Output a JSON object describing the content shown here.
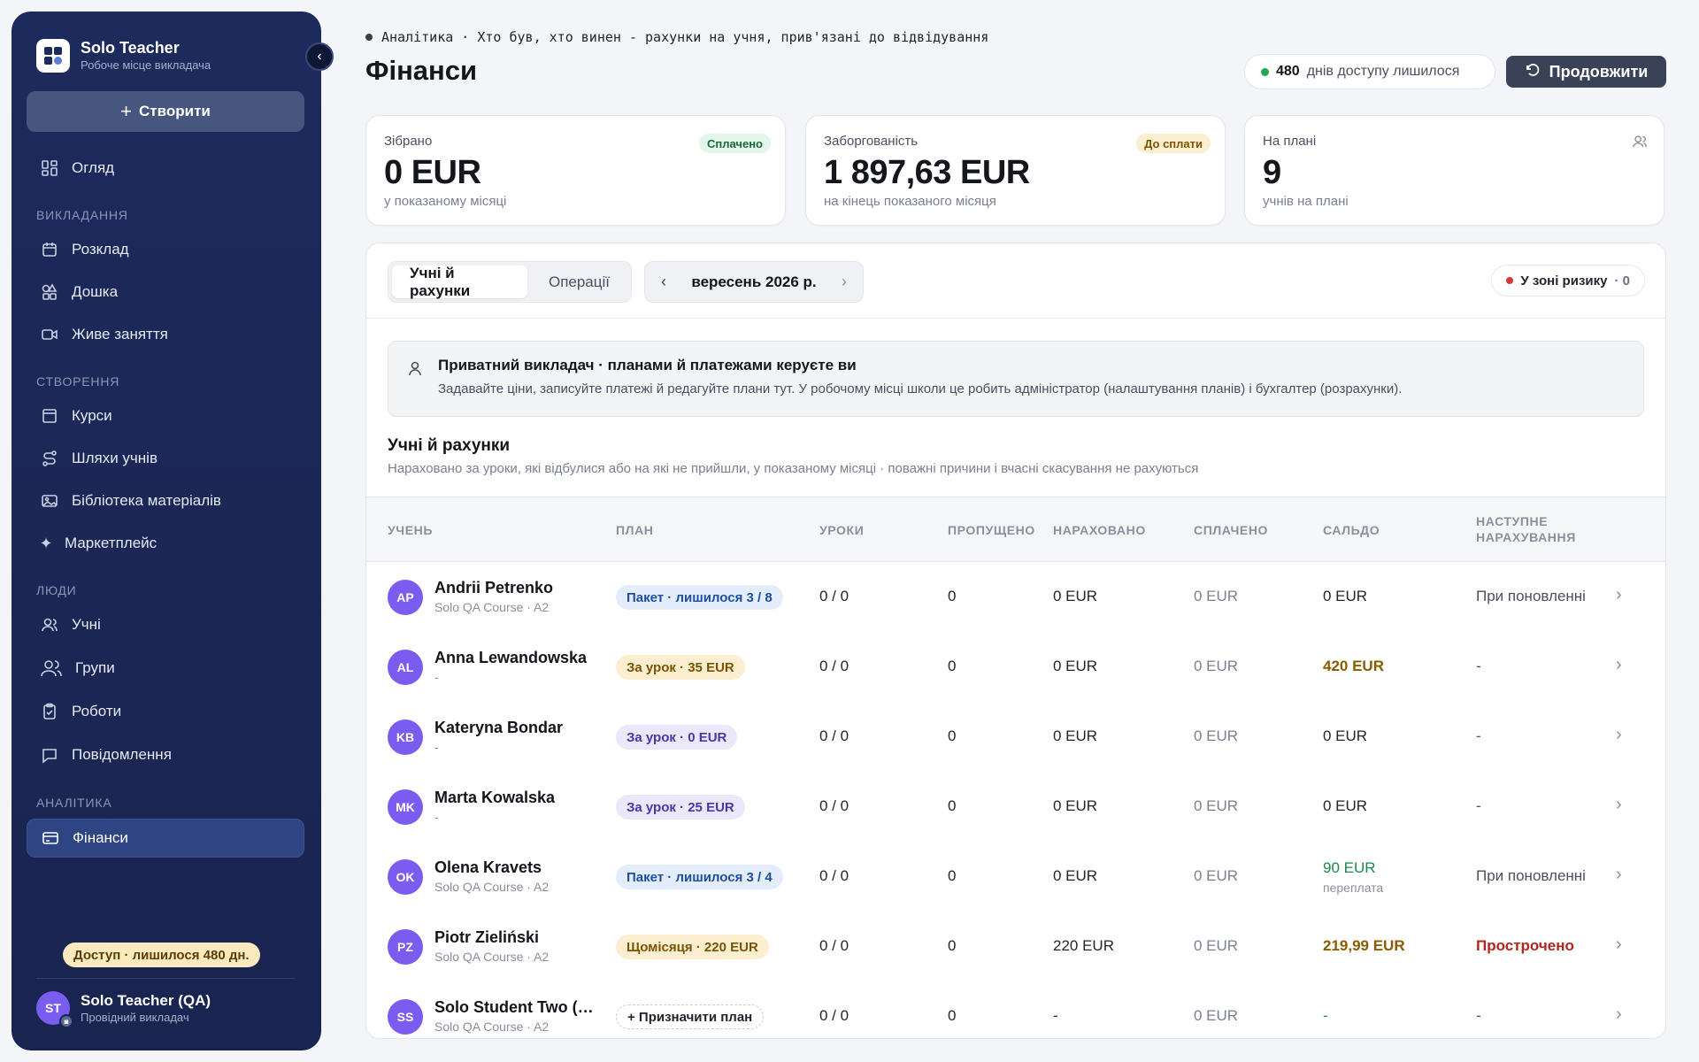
{
  "sidebar": {
    "brand_name": "Solo Teacher",
    "brand_sub": "Робоче місце викладача",
    "create_label": "Створити",
    "overview": "Огляд",
    "section_teaching": "ВИКЛАДАННЯ",
    "schedule": "Розклад",
    "board": "Дошка",
    "live": "Живе заняття",
    "section_creation": "СТВОРЕННЯ",
    "courses": "Курси",
    "paths": "Шляхи учнів",
    "library": "Бібліотека матеріалів",
    "marketplace": "Маркетплейс",
    "section_people": "ЛЮДИ",
    "students": "Учні",
    "groups": "Групи",
    "works": "Роботи",
    "messages": "Повідомлення",
    "section_analytics": "АНАЛІТИКА",
    "finance": "Фінанси",
    "access": "Доступ · лишилося 480 дн.",
    "user_initials": "ST",
    "user_name": "Solo Teacher (QA)",
    "user_role": "Провідний викладач"
  },
  "header": {
    "breadcrumb": "Аналітика · Хто був, хто винен - рахунки на учня, прив'язані до відвідування",
    "title": "Фінанси",
    "days_count": "480",
    "days_text": "днів доступу лишилося",
    "renew_label": "Продовжити"
  },
  "cards": {
    "collected": {
      "label": "Зібрано",
      "badge": "Сплачено",
      "value": "0 EUR",
      "sub": "у показаному місяці"
    },
    "debt": {
      "label": "Заборгованість",
      "badge": "До сплати",
      "value": "1 897,63 EUR",
      "sub": "на кінець показаного місяця"
    },
    "on_plan": {
      "label": "На плані",
      "value": "9",
      "sub": "учнів на плані"
    }
  },
  "panel": {
    "tab_students": "Учні й рахунки",
    "tab_operations": "Операції",
    "month": "вересень 2026 р.",
    "risk_label": "У зоні ризику",
    "risk_count": "· 0",
    "info_title": "Приватний викладач · планами й платежами керуєте ви",
    "info_text": "Задавайте ціни, записуйте платежі й редагуйте плани тут. У робочому місці школи це робить адміністратор (налаштування планів) і бухгалтер (розрахунки).",
    "section_title": "Учні й рахунки",
    "section_sub": "Нараховано за уроки, які відбулися або на які не прийшли, у показаному місяці · поважні причини і вчасні скасування не рахуються"
  },
  "table": {
    "headers": {
      "student": "УЧЕНЬ",
      "plan": "ПЛАН",
      "lessons": "УРОКИ",
      "missed": "ПРОПУЩЕНО",
      "charged": "НАРАХОВАНО",
      "paid": "СПЛАЧЕНО",
      "balance": "САЛЬДО",
      "next_1": "НАСТУПНЕ",
      "next_2": "НАРАХУВАННЯ"
    },
    "rows": [
      {
        "initials": "AP",
        "name": "Andrii Petrenko",
        "sub": "Solo QA Course · A2",
        "plan": "Пакет · лишилося 3 / 8",
        "lessons": "0 / 0",
        "missed": "0",
        "charged": "0 EUR",
        "paid": "0 EUR",
        "balance": "0 EUR",
        "balance_sub": "",
        "next": "При поновленні"
      },
      {
        "initials": "AL",
        "name": "Anna Lewandowska",
        "sub": "-",
        "plan": "За урок · 35 EUR",
        "lessons": "0 / 0",
        "missed": "0",
        "charged": "0 EUR",
        "paid": "0 EUR",
        "balance": "420 EUR",
        "balance_sub": "",
        "next": "-"
      },
      {
        "initials": "KB",
        "name": "Kateryna Bondar",
        "sub": "-",
        "plan": "За урок · 0 EUR",
        "lessons": "0 / 0",
        "missed": "0",
        "charged": "0 EUR",
        "paid": "0 EUR",
        "balance": "0 EUR",
        "balance_sub": "",
        "next": "-"
      },
      {
        "initials": "MK",
        "name": "Marta Kowalska",
        "sub": "-",
        "plan": "За урок · 25 EUR",
        "lessons": "0 / 0",
        "missed": "0",
        "charged": "0 EUR",
        "paid": "0 EUR",
        "balance": "0 EUR",
        "balance_sub": "",
        "next": "-"
      },
      {
        "initials": "OK",
        "name": "Olena Kravets",
        "sub": "Solo QA Course · A2",
        "plan": "Пакет · лишилося 3 / 4",
        "lessons": "0 / 0",
        "missed": "0",
        "charged": "0 EUR",
        "paid": "0 EUR",
        "balance": "90 EUR",
        "balance_sub": "переплата",
        "next": "При поновленні"
      },
      {
        "initials": "PZ",
        "name": "Piotr Zieliński",
        "sub": "Solo QA Course · A2",
        "plan": "Щомісяця · 220 EUR",
        "lessons": "0 / 0",
        "missed": "0",
        "charged": "220 EUR",
        "paid": "0 EUR",
        "balance": "219,99 EUR",
        "balance_sub": "",
        "next": "Прострочено"
      },
      {
        "initials": "SS",
        "name": "Solo Student Two (QA)",
        "sub": "Solo QA Course · A2",
        "plan": "+ Призначити план",
        "lessons": "0 / 0",
        "missed": "0",
        "charged": "-",
        "paid": "0 EUR",
        "balance": "-",
        "balance_sub": "",
        "next": "-"
      }
    ]
  },
  "colors": {
    "sidebar_bg": "#1d2a5c",
    "accent_purple": "#7a5cf0",
    "balance_due": "#8a5c00",
    "overpaid": "#1c8a4a",
    "overdue": "#b3261e"
  }
}
